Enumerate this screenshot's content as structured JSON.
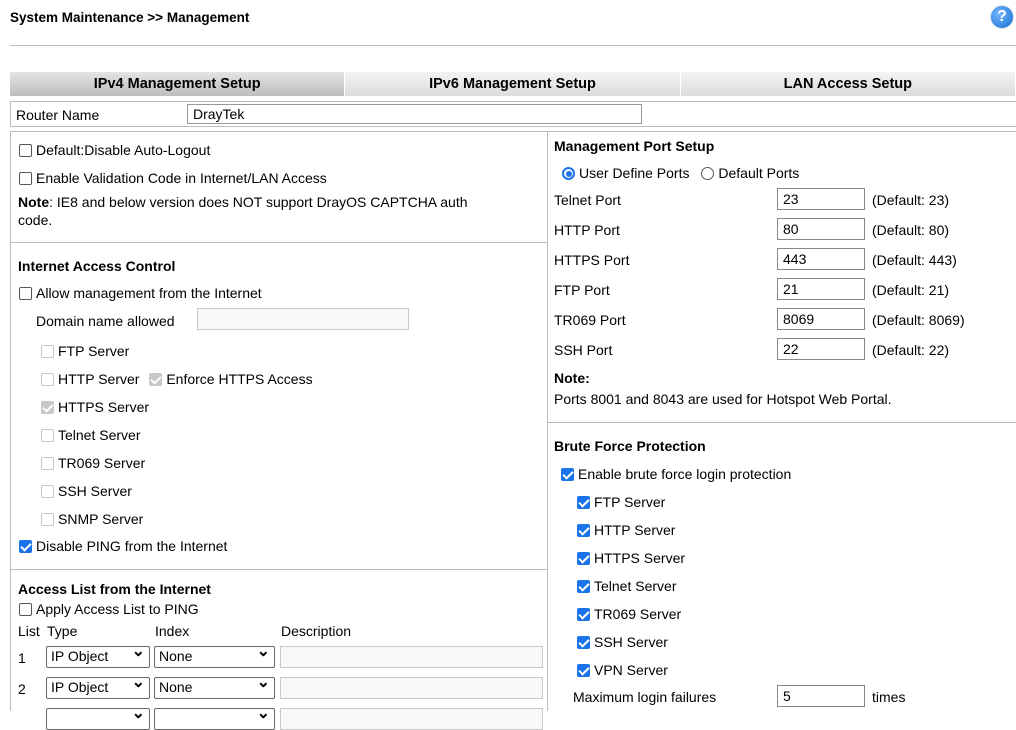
{
  "header": {
    "breadcrumb": "System Maintenance >> Management",
    "help": "?"
  },
  "tabs": [
    "IPv4 Management Setup",
    "IPv6 Management Setup",
    "LAN Access Setup"
  ],
  "router_name": {
    "label": "Router Name",
    "value": "DrayTek"
  },
  "left": {
    "default_disable_autologout": "Default:Disable Auto-Logout",
    "enable_validation_code": "Enable Validation Code in Internet/LAN Access",
    "note_bold": "Note",
    "note_line1": ": IE8 and below version does NOT support DrayOS CAPTCHA auth",
    "note_line2": "code.",
    "internet_access_control": "Internet Access Control",
    "allow_mgmt": "Allow management from the Internet",
    "domain_name_allowed": "Domain name allowed",
    "domain_value": "",
    "ftp": "FTP Server",
    "http": "HTTP Server",
    "enforce_https": "Enforce HTTPS Access",
    "https": "HTTPS Server",
    "telnet": "Telnet Server",
    "tr069": "TR069 Server",
    "ssh": "SSH Server",
    "snmp": "SNMP Server",
    "disable_ping": "Disable PING from the Internet",
    "access_list_title": "Access List from the Internet",
    "apply_access_list": "Apply Access List to PING",
    "col_list": "List",
    "col_type": "Type",
    "col_index": "Index",
    "col_description": "Description",
    "rows": [
      {
        "num": "1",
        "type": "IP Object",
        "index": "None"
      },
      {
        "num": "2",
        "type": "IP Object",
        "index": "None"
      }
    ]
  },
  "right": {
    "mgmt_port_setup": "Management Port Setup",
    "user_define_ports": "User Define Ports",
    "default_ports": "Default Ports",
    "ports": [
      {
        "label": "Telnet Port",
        "value": "23",
        "default": "(Default: 23)"
      },
      {
        "label": "HTTP Port",
        "value": "80",
        "default": "(Default: 80)"
      },
      {
        "label": "HTTPS Port",
        "value": "443",
        "default": "(Default: 443)"
      },
      {
        "label": "FTP Port",
        "value": "21",
        "default": "(Default: 21)"
      },
      {
        "label": "TR069 Port",
        "value": "8069",
        "default": "(Default: 8069)"
      },
      {
        "label": "SSH Port",
        "value": "22",
        "default": "(Default: 22)"
      }
    ],
    "note_label": "Note:",
    "note_text": "Ports 8001 and 8043 are used for Hotspot Web Portal.",
    "brute_force_title": "Brute Force Protection",
    "enable_brute_force": "Enable brute force login protection",
    "bf_items": [
      "FTP Server",
      "HTTP Server",
      "HTTPS Server",
      "Telnet Server",
      "TR069 Server",
      "SSH Server",
      "VPN Server"
    ],
    "max_login_failures": "Maximum login failures",
    "max_login_value": "5",
    "times": "times"
  },
  "colors": {
    "accent": "#1a73e8",
    "tab_active": "#bdbdbd",
    "tab": "#dcdcdc"
  }
}
